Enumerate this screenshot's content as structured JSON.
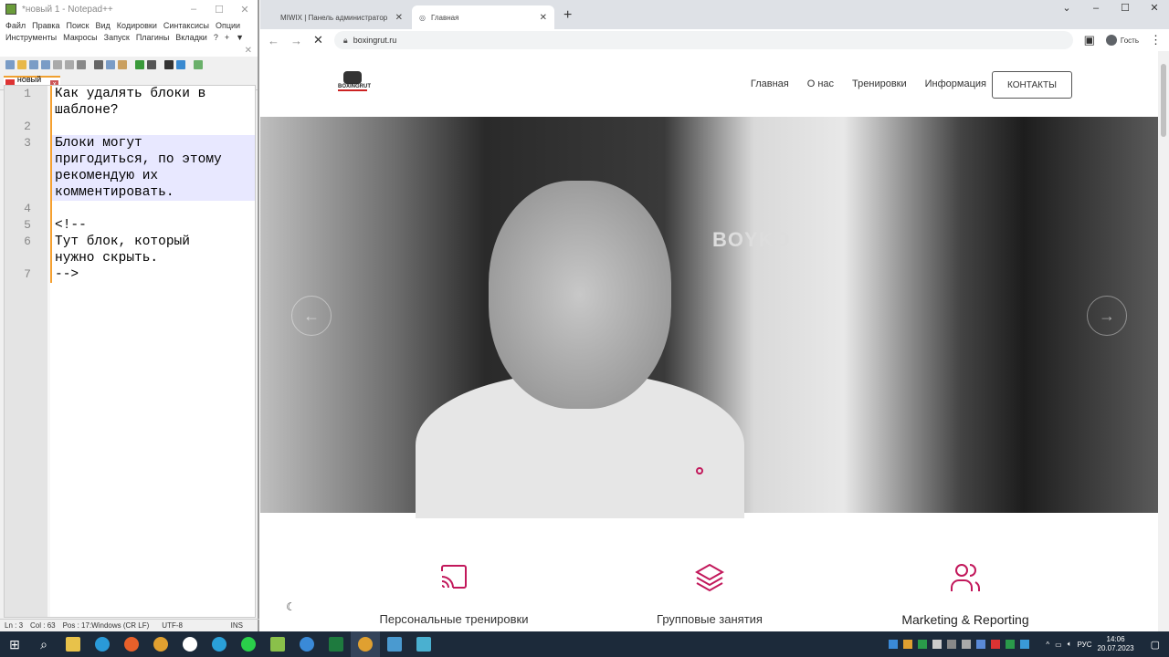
{
  "notepad": {
    "title": "*новый 1 - Notepad++",
    "menu": [
      "Файл",
      "Правка",
      "Поиск",
      "Вид",
      "Кодировки",
      "Синтаксисы",
      "Опции",
      "Инструменты",
      "Макросы",
      "Запуск",
      "Плагины",
      "Вкладки",
      "?",
      "+",
      "▼"
    ],
    "tab": "новый 1",
    "lines": [
      {
        "n": "1",
        "text": "Как удалять блоки в\nшаблоне?"
      },
      {
        "n": "2",
        "text": ""
      },
      {
        "n": "3",
        "text": "Блоки могут\nпригодиться, по этому\nрекомендую их\nкомментировать."
      },
      {
        "n": "4",
        "text": ""
      },
      {
        "n": "5",
        "text": "<!--"
      },
      {
        "n": "6",
        "text": "Тут блок, который\nнужно скрыть."
      },
      {
        "n": "7",
        "text": "-->"
      }
    ],
    "status": {
      "ln": "Ln : 3",
      "col": "Col : 63",
      "pos": "Pos : 17:",
      "eol": "Windows (CR LF)",
      "enc": "UTF-8",
      "mode": "INS"
    }
  },
  "browser": {
    "tabs": [
      {
        "title": "MIWIX | Панель администратор"
      },
      {
        "title": "Главная"
      }
    ],
    "url": "boxingrut.ru",
    "profile": "Гость"
  },
  "site": {
    "logo": "BOXINGRUT",
    "nav": [
      "Главная",
      "О нас",
      "Тренировки",
      "Информация"
    ],
    "contact": "КОНТАКТЫ",
    "hero_brand": "BOYKO",
    "features": [
      "Персональные тренировки",
      "Групповые занятия",
      "Marketing & Reporting"
    ],
    "accent": "#c2185b"
  },
  "taskbar": {
    "lang": "РУС",
    "time": "14:06",
    "date": "20.07.2023"
  }
}
